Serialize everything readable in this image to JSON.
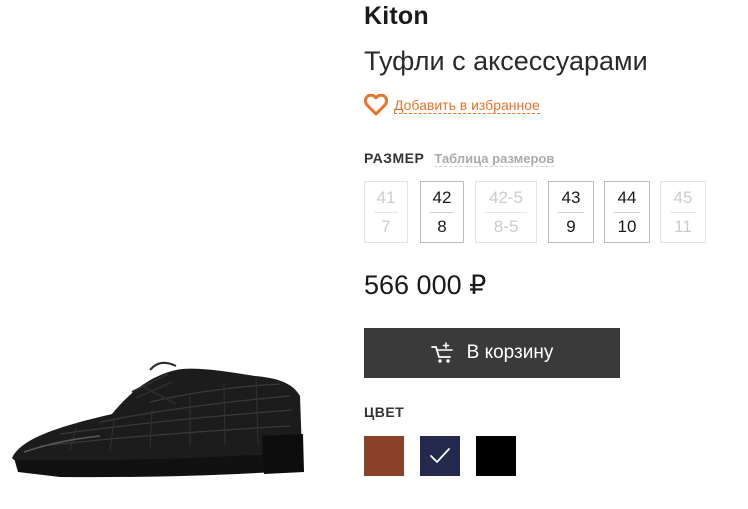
{
  "product": {
    "brand": "Kiton",
    "title": "Туфли с аксессуарами",
    "favorite_label": "Добавить в избранное",
    "price": "566 000 ₽"
  },
  "size_section": {
    "label": "РАЗМЕР",
    "chart_link": "Таблица размеров",
    "options": [
      {
        "eu": "41",
        "uk": "7",
        "available": false
      },
      {
        "eu": "42",
        "uk": "8",
        "available": true
      },
      {
        "eu": "42-5",
        "uk": "8-5",
        "available": false
      },
      {
        "eu": "43",
        "uk": "9",
        "available": true
      },
      {
        "eu": "44",
        "uk": "10",
        "available": true
      },
      {
        "eu": "45",
        "uk": "11",
        "available": false
      }
    ]
  },
  "cart_button": {
    "label": "В корзину",
    "icon": "cart-add-icon"
  },
  "color_section": {
    "label": "ЦВЕТ",
    "swatches": [
      {
        "color": "#8b4228",
        "selected": false
      },
      {
        "color": "#232a4e",
        "selected": true
      },
      {
        "color": "#000000",
        "selected": false
      }
    ]
  },
  "colors": {
    "accent": "#e8732a",
    "button_bg": "#3a3a3a"
  }
}
